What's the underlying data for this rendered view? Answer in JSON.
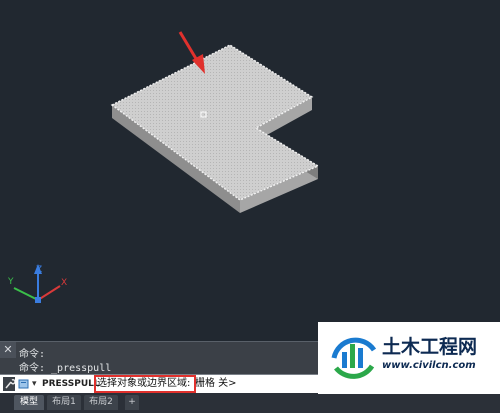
{
  "history": {
    "line1": "命令:",
    "line2": "命令: _presspull"
  },
  "command_line": {
    "name": "PRESSPULL",
    "prompt": "选择对象或边界区域:",
    "option": "栅格 关>"
  },
  "tabs": {
    "model": "模型",
    "layout1": "布局1",
    "layout2": "布局2",
    "add": "+"
  },
  "ucs": {
    "x": "X",
    "y": "Y",
    "z": "Z"
  },
  "watermark": {
    "name": "土木工程网",
    "url": "www.civilcn.com"
  },
  "colors": {
    "viewport_bg": "#212830",
    "arrow_red": "#e0312d",
    "solid_top": "#c8c8c8"
  },
  "icons": {
    "close": "close-icon",
    "wrench": "wrench-icon",
    "command": "command-icon"
  }
}
